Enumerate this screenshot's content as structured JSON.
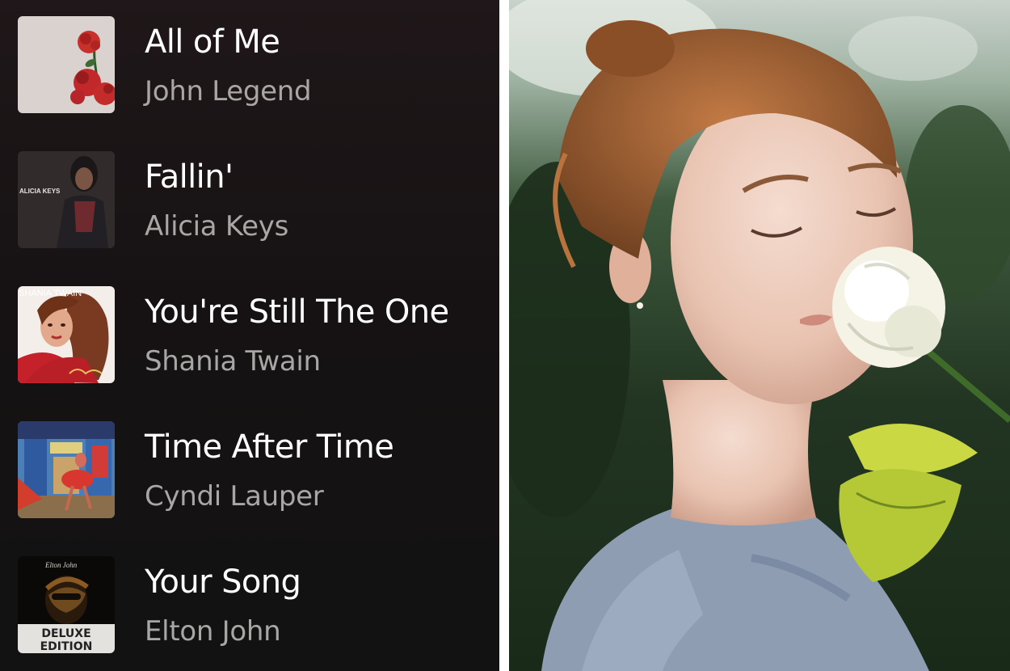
{
  "tracks": [
    {
      "title": "All of Me",
      "artist": "John Legend",
      "cover_icon": "rose-album-cover"
    },
    {
      "title": "Fallin'",
      "artist": "Alicia Keys",
      "cover_icon": "portrait-album-cover"
    },
    {
      "title": "You're Still The One",
      "artist": "Shania Twain",
      "cover_icon": "portrait-album-cover"
    },
    {
      "title": "Time After Time",
      "artist": "Cyndi Lauper",
      "cover_icon": "street-scene-album-cover"
    },
    {
      "title": "Your Song",
      "artist": "Elton John",
      "cover_icon": "portrait-album-cover"
    }
  ],
  "covers": {
    "alicia_banner": "ALICIA KEYS",
    "shania_banner": "SHANIA TWAIN",
    "elton_signature": "Elton John",
    "elton_badge_line1": "DELUXE",
    "elton_badge_line2": "EDITION"
  },
  "colors": {
    "list_background": "#121212",
    "title_text": "#ffffff",
    "artist_text": "#a9a6a6"
  }
}
